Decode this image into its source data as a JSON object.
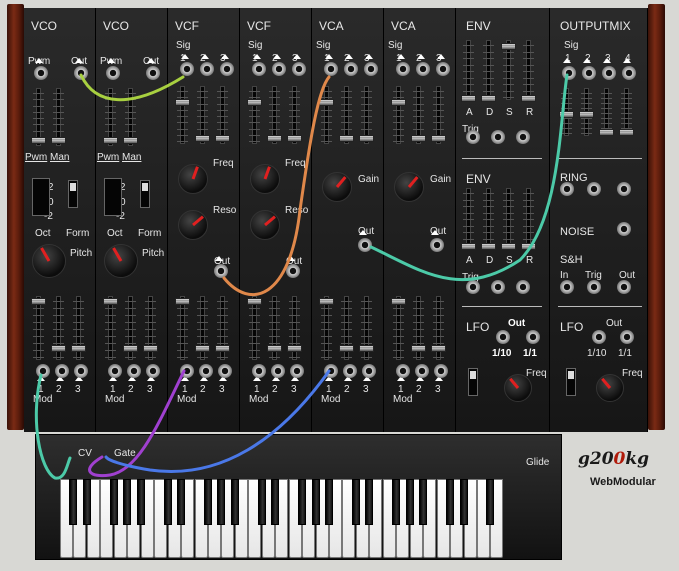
{
  "modules": {
    "vco1": {
      "title": "VCO",
      "out": "Out",
      "pwm": "Pwm",
      "pwm_sub": "Pwm",
      "man": "Man",
      "oct": "Oct",
      "form": "Form",
      "pitch": "Pitch",
      "oct_values": [
        "+2",
        "0",
        "-2"
      ],
      "mod": "Mod",
      "mod_nums": [
        "1",
        "2",
        "3"
      ]
    },
    "vco2": {
      "title": "VCO",
      "out": "Out",
      "pwm": "Pwm",
      "pwm_sub": "Pwm",
      "man": "Man",
      "oct": "Oct",
      "form": "Form",
      "pitch": "Pitch",
      "oct_values": [
        "+2",
        "0",
        "-2"
      ],
      "mod": "Mod",
      "mod_nums": [
        "1",
        "2",
        "3"
      ]
    },
    "vcf1": {
      "title": "VCF",
      "sig": "Sig",
      "sig_nums": [
        "1",
        "2",
        "3"
      ],
      "freq": "Freq",
      "reso": "Reso",
      "out": "Out",
      "mod": "Mod",
      "mod_nums": [
        "1",
        "2",
        "3"
      ]
    },
    "vcf2": {
      "title": "VCF",
      "sig": "Sig",
      "sig_nums": [
        "1",
        "2",
        "3"
      ],
      "freq": "Freq",
      "reso": "Reso",
      "out": "Out",
      "mod": "Mod",
      "mod_nums": [
        "1",
        "2",
        "3"
      ]
    },
    "vca1": {
      "title": "VCA",
      "sig": "Sig",
      "sig_nums": [
        "1",
        "2",
        "3"
      ],
      "gain": "Gain",
      "out": "Out",
      "mod": "Mod",
      "mod_nums": [
        "1",
        "2",
        "3"
      ]
    },
    "vca2": {
      "title": "VCA",
      "sig": "Sig",
      "sig_nums": [
        "1",
        "2",
        "3"
      ],
      "gain": "Gain",
      "out": "Out",
      "mod": "Mod",
      "mod_nums": [
        "1",
        "2",
        "3"
      ]
    },
    "env": {
      "title": "ENV",
      "adsr": [
        "A",
        "D",
        "S",
        "R"
      ],
      "trig": "Trig"
    },
    "env2": {
      "title": "ENV",
      "adsr": [
        "A",
        "D",
        "S",
        "R"
      ],
      "trig": "Trig"
    },
    "lfo1": {
      "title": "LFO",
      "out": "Out",
      "rate1": "1/10",
      "rate2": "1/1",
      "freq": "Freq"
    },
    "outputmix": {
      "title": "OUTPUTMIX",
      "sig": "Sig",
      "sig_nums": [
        "1",
        "2",
        "3",
        "4"
      ]
    },
    "ring": {
      "title": "RING"
    },
    "noise": {
      "title": "NOISE"
    },
    "sh": {
      "title": "S&H",
      "in": "In",
      "trig": "Trig",
      "out": "Out"
    },
    "lfo2": {
      "title": "LFO",
      "out": "Out",
      "rate1": "1/10",
      "rate2": "1/1",
      "freq": "Freq"
    }
  },
  "keyboard": {
    "cv": "CV",
    "gate": "Gate",
    "glide": "Glide"
  },
  "brand": {
    "name_a": "g20",
    "name_b": "0",
    "name_c": "kg",
    "product": "WebModular"
  },
  "cable_colors": {
    "green": "#a8d040",
    "orange": "#e0884a",
    "teal": "#4ccaa8",
    "purple": "#a040d0",
    "blue": "#4a78e8"
  }
}
